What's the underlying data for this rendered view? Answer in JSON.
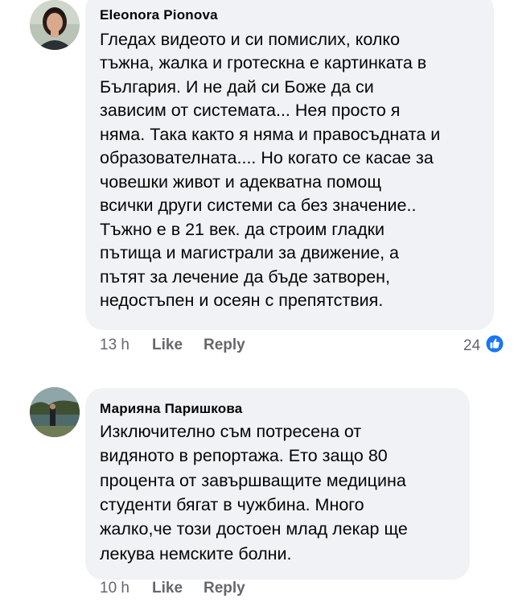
{
  "colors": {
    "bubble_bg": "#f0f2f5",
    "meta_text": "#65676b",
    "like_blue": "#1877f2"
  },
  "comments": [
    {
      "author": "Eleonora Pionova",
      "avatar_icon": "profile-photo",
      "lines": [
        "Гледах видеото и си помислих, колко",
        "тъжна, жалка и гротескна е картинката в",
        "България. И не дай си Боже да си",
        "зависим от системата... Нея просто я",
        "няма. Така както я няма и правосъдната и",
        "образователната.... Но когато се касае за",
        "човешки живот и адекватна помощ",
        "всички други системи са без значение..",
        "Тъжно е в  21 век. да строим гладки",
        "пътища и магистрали за  движение, а",
        "пътят за лечение да бъде затворен,",
        "недостъпен и осеян с препятствия."
      ],
      "time": "13 h",
      "like_label": "Like",
      "reply_label": "Reply",
      "reaction_count": "24",
      "reaction_icon": "like-thumbs-up-icon"
    },
    {
      "author": "Марияна Паришкова",
      "avatar_icon": "profile-photo",
      "lines": [
        "Изключително съм потресена от",
        "видяното в репортажа. Ето защо 80",
        "процента от завършващите медицина",
        "студенти бягат в чужбина.      Много",
        "жалко,че този достоен млад лекар ще",
        "лекува немските болни."
      ],
      "time": "10 h",
      "like_label": "Like",
      "reply_label": "Reply"
    }
  ]
}
